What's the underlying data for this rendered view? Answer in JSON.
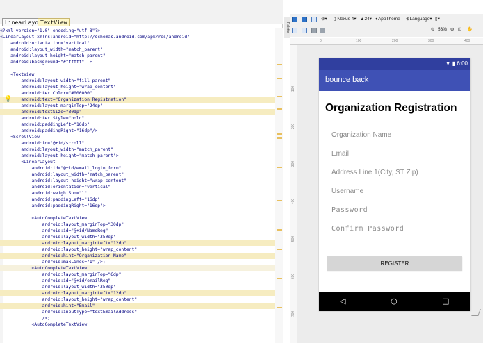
{
  "editor": {
    "breadcrumbs": [
      "LinearLayout",
      "TextView"
    ],
    "lines": [
      {
        "text": "<?xml version=\"1.0\" encoding=\"utf-8\"?>",
        "style": ""
      },
      {
        "text": "<LinearLayout xmlns:android=\"http://schemas.android.com/apk/res/android\"",
        "style": ""
      },
      {
        "text": "    android:orientation=\"vertical\"",
        "style": ""
      },
      {
        "text": "    android:layout_width=\"match_parent\"",
        "style": ""
      },
      {
        "text": "    android:layout_height=\"match_parent\"",
        "style": ""
      },
      {
        "text": "    android:background=\"#ffffff\"  >",
        "style": ""
      },
      {
        "text": "",
        "style": ""
      },
      {
        "text": "    <TextView",
        "style": ""
      },
      {
        "text": "        android:layout_width=\"fill_parent\"",
        "style": ""
      },
      {
        "text": "        android:layout_height=\"wrap_content\"",
        "style": ""
      },
      {
        "text": "        android:textColor=\"#000000\"",
        "style": ""
      },
      {
        "text": "        android:text=\"Organization Registration\"",
        "style": "sel"
      },
      {
        "text": "        android:layout_marginTop=\"24dp\"",
        "style": ""
      },
      {
        "text": "        android:textSize=\"30dp\"",
        "style": "sel"
      },
      {
        "text": "        android:textStyle=\"bold\"",
        "style": ""
      },
      {
        "text": "        android:paddingLeft=\"16dp\"",
        "style": ""
      },
      {
        "text": "        android:paddingRight=\"16dp\"/>",
        "style": ""
      },
      {
        "text": "    <ScrollView",
        "style": ""
      },
      {
        "text": "        android:id=\"@+id/scroll\"",
        "style": ""
      },
      {
        "text": "        android:layout_width=\"match_parent\"",
        "style": ""
      },
      {
        "text": "        android:layout_height=\"match_parent\">",
        "style": ""
      },
      {
        "text": "        <LinearLayout",
        "style": ""
      },
      {
        "text": "            android:id=\"@+id/email_login_form\"",
        "style": ""
      },
      {
        "text": "            android:layout_width=\"match_parent\"",
        "style": ""
      },
      {
        "text": "            android:layout_height=\"wrap_content\"",
        "style": ""
      },
      {
        "text": "            android:orientation=\"vertical\"",
        "style": ""
      },
      {
        "text": "            android:weightSum=\"1\"",
        "style": ""
      },
      {
        "text": "            android:paddingLeft=\"16dp\"",
        "style": ""
      },
      {
        "text": "            android:paddingRight=\"16dp\">",
        "style": ""
      },
      {
        "text": "",
        "style": ""
      },
      {
        "text": "            <AutoCompleteTextView",
        "style": ""
      },
      {
        "text": "                android:layout_marginTop=\"30dp\"",
        "style": ""
      },
      {
        "text": "                android:id=\"@+id/NameReg\"",
        "style": ""
      },
      {
        "text": "                android:layout_width=\"350dp\"",
        "style": ""
      },
      {
        "text": "                android:layout_marginLeft=\"12dp\"",
        "style": "sel"
      },
      {
        "text": "                android:layout_height=\"wrap_content\"",
        "style": ""
      },
      {
        "text": "                android:hint=\"Organization Name\"",
        "style": "sel"
      },
      {
        "text": "                android:maxLines=\"1\" />;",
        "style": ""
      },
      {
        "text": "            <AutoCompleteTextView",
        "style": "cur"
      },
      {
        "text": "                android:layout_marginTop=\"6dp\"",
        "style": ""
      },
      {
        "text": "                android:id=\"@+id/emailReg\"",
        "style": ""
      },
      {
        "text": "                android:layout_width=\"350dp\"",
        "style": ""
      },
      {
        "text": "                android:layout_marginLeft=\"12dp\"",
        "style": "sel"
      },
      {
        "text": "                android:layout_height=\"wrap_content\"",
        "style": ""
      },
      {
        "text": "                android:hint=\"Email\"",
        "style": "sel"
      },
      {
        "text": "                android:inputType=\"textEmailAddress\"",
        "style": ""
      },
      {
        "text": "                />;",
        "style": ""
      },
      {
        "text": "            <AutoCompleteTextView",
        "style": ""
      }
    ]
  },
  "toolbar": {
    "device": "Nexus 4",
    "api": "24",
    "theme": "AppTheme",
    "language": "Language",
    "zoom": "53%",
    "side_label": "Palette"
  },
  "ruler": {
    "top": [
      "0",
      "100",
      "200",
      "300",
      "400"
    ],
    "left": [
      "100",
      "200",
      "300",
      "400",
      "500",
      "600",
      "700"
    ]
  },
  "device": {
    "status_time": "6:00",
    "app_title": "bounce back",
    "page_title": "Organization Registration",
    "hints": [
      "Organization Name",
      "Email",
      "Address Line 1(City, ST Zip)",
      "Username",
      "Password",
      "Confirm Password"
    ],
    "register_label": "REGISTER",
    "nav": {
      "back": "◁",
      "home": "○",
      "recents": "□"
    }
  },
  "colors": {
    "status_bar": "#303f9f",
    "app_bar": "#3f51b5",
    "button": "#d6d6d6",
    "hint_text": "#8a8a8a"
  }
}
